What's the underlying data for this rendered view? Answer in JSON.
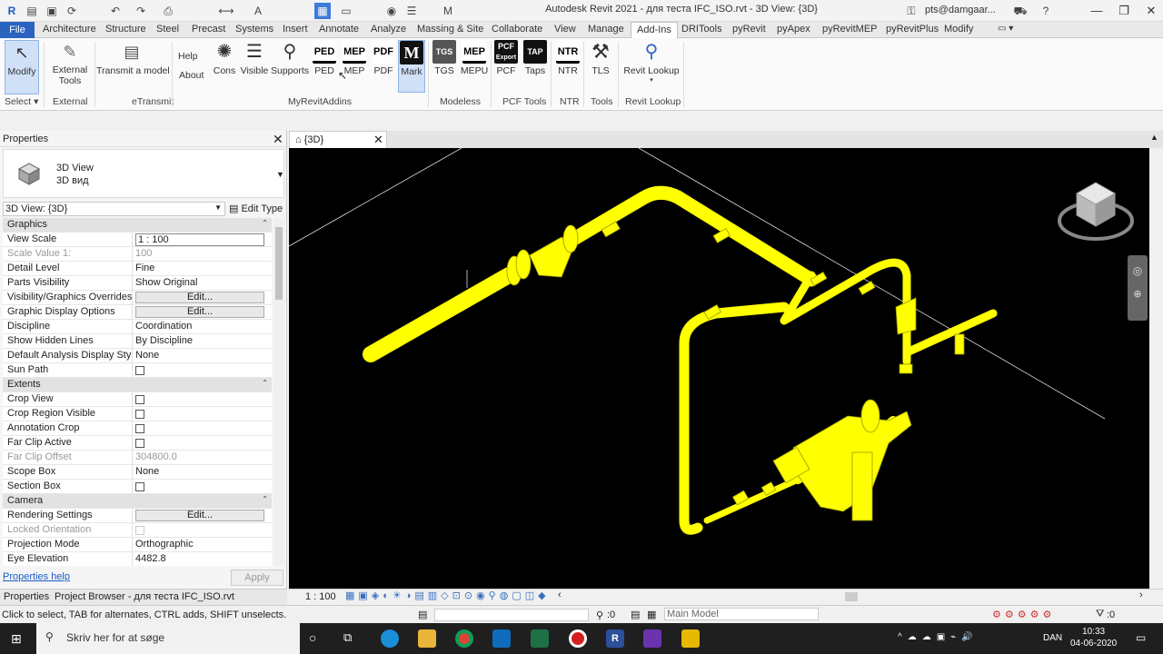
{
  "window": {
    "title": "Autodesk Revit 2021 - для теста IFC_ISO.rvt - 3D View: {3D}",
    "user": "pts@damgaar..."
  },
  "tabs": [
    "File",
    "Architecture",
    "Structure",
    "Steel",
    "Precast",
    "Systems",
    "Insert",
    "Annotate",
    "Analyze",
    "Massing & Site",
    "Collaborate",
    "View",
    "Manage",
    "Add-Ins",
    "DRITools",
    "pyRevit",
    "pyApex",
    "pyRevitMEP",
    "pyRevitPlus",
    "Modify"
  ],
  "active_tab": "Add-Ins",
  "ribbon": {
    "buttons": [
      {
        "label": "Modify"
      },
      {
        "label": "External\nTools"
      },
      {
        "label": "Transmit a model"
      },
      {
        "label": "Help"
      },
      {
        "label": "About"
      },
      {
        "label": "Cons"
      },
      {
        "label": "Visible"
      },
      {
        "label": "Supports"
      },
      {
        "label": "PED",
        "icon": "PED"
      },
      {
        "label": "MEP",
        "icon": "MEP"
      },
      {
        "label": "PDF",
        "icon": "PDF"
      },
      {
        "label": "Mark",
        "icon": "M"
      },
      {
        "label": "TGS",
        "icon": "TGS"
      },
      {
        "label": "MEPU",
        "icon": "MEP"
      },
      {
        "label": "PCF",
        "icon": "PCF"
      },
      {
        "label": "Taps",
        "icon": "TAP"
      },
      {
        "label": "NTR",
        "icon": "NTR"
      },
      {
        "label": "TLS"
      },
      {
        "label": "Revit Lookup"
      }
    ],
    "pcf_export": "Export",
    "groups": [
      "Select",
      "External",
      "eTransmit",
      "MyRevitAddins",
      "Modeless",
      "PCF Tools",
      "NTR",
      "Tools",
      "Revit Lookup"
    ]
  },
  "properties": {
    "title": "Properties",
    "type_name": "3D View",
    "type_subname": "3D вид",
    "view_selector": "3D View: {3D}",
    "edit_type": "Edit Type",
    "sections": [
      {
        "name": "Graphics",
        "rows": [
          {
            "k": "View Scale",
            "v": "1 : 100",
            "kind": "input"
          },
          {
            "k": "Scale Value    1:",
            "v": "100",
            "dim": true
          },
          {
            "k": "Detail Level",
            "v": "Fine"
          },
          {
            "k": "Parts Visibility",
            "v": "Show Original"
          },
          {
            "k": "Visibility/Graphics Overrides",
            "v": "Edit...",
            "kind": "button"
          },
          {
            "k": "Graphic Display Options",
            "v": "Edit...",
            "kind": "button"
          },
          {
            "k": "Discipline",
            "v": "Coordination"
          },
          {
            "k": "Show Hidden Lines",
            "v": "By Discipline"
          },
          {
            "k": "Default Analysis Display Style",
            "v": "None"
          },
          {
            "k": "Sun Path",
            "v": "",
            "kind": "check"
          }
        ]
      },
      {
        "name": "Extents",
        "rows": [
          {
            "k": "Crop View",
            "v": "",
            "kind": "check"
          },
          {
            "k": "Crop Region Visible",
            "v": "",
            "kind": "check"
          },
          {
            "k": "Annotation Crop",
            "v": "",
            "kind": "check"
          },
          {
            "k": "Far Clip Active",
            "v": "",
            "kind": "check"
          },
          {
            "k": "Far Clip Offset",
            "v": "304800.0",
            "dim": true
          },
          {
            "k": "Scope Box",
            "v": "None"
          },
          {
            "k": "Section Box",
            "v": "",
            "kind": "check"
          }
        ]
      },
      {
        "name": "Camera",
        "rows": [
          {
            "k": "Rendering Settings",
            "v": "Edit...",
            "kind": "button"
          },
          {
            "k": "Locked Orientation",
            "v": "",
            "kind": "check",
            "dim": true
          },
          {
            "k": "Projection Mode",
            "v": "Orthographic"
          },
          {
            "k": "Eye Elevation",
            "v": "4482.8"
          }
        ]
      }
    ],
    "help_link": "Properties help",
    "apply": "Apply",
    "bottom_tabs": [
      "Properties",
      "Project Browser - для теста IFC_ISO.rvt"
    ]
  },
  "view": {
    "tab": "{3D}",
    "scale": "1 : 100"
  },
  "status": {
    "message": "Click to select, TAB for alternates, CTRL adds, SHIFT unselects.",
    "zero": ":0",
    "model": "Main Model",
    "filter": ":0"
  },
  "taskbar": {
    "search": "Skriv her for at søge",
    "lang": "DAN",
    "time": "10:33",
    "date": "04-06-2020"
  },
  "colors": {
    "accent": "#2b64c0",
    "pipe": "#ffff00",
    "viewport": "#000000"
  }
}
